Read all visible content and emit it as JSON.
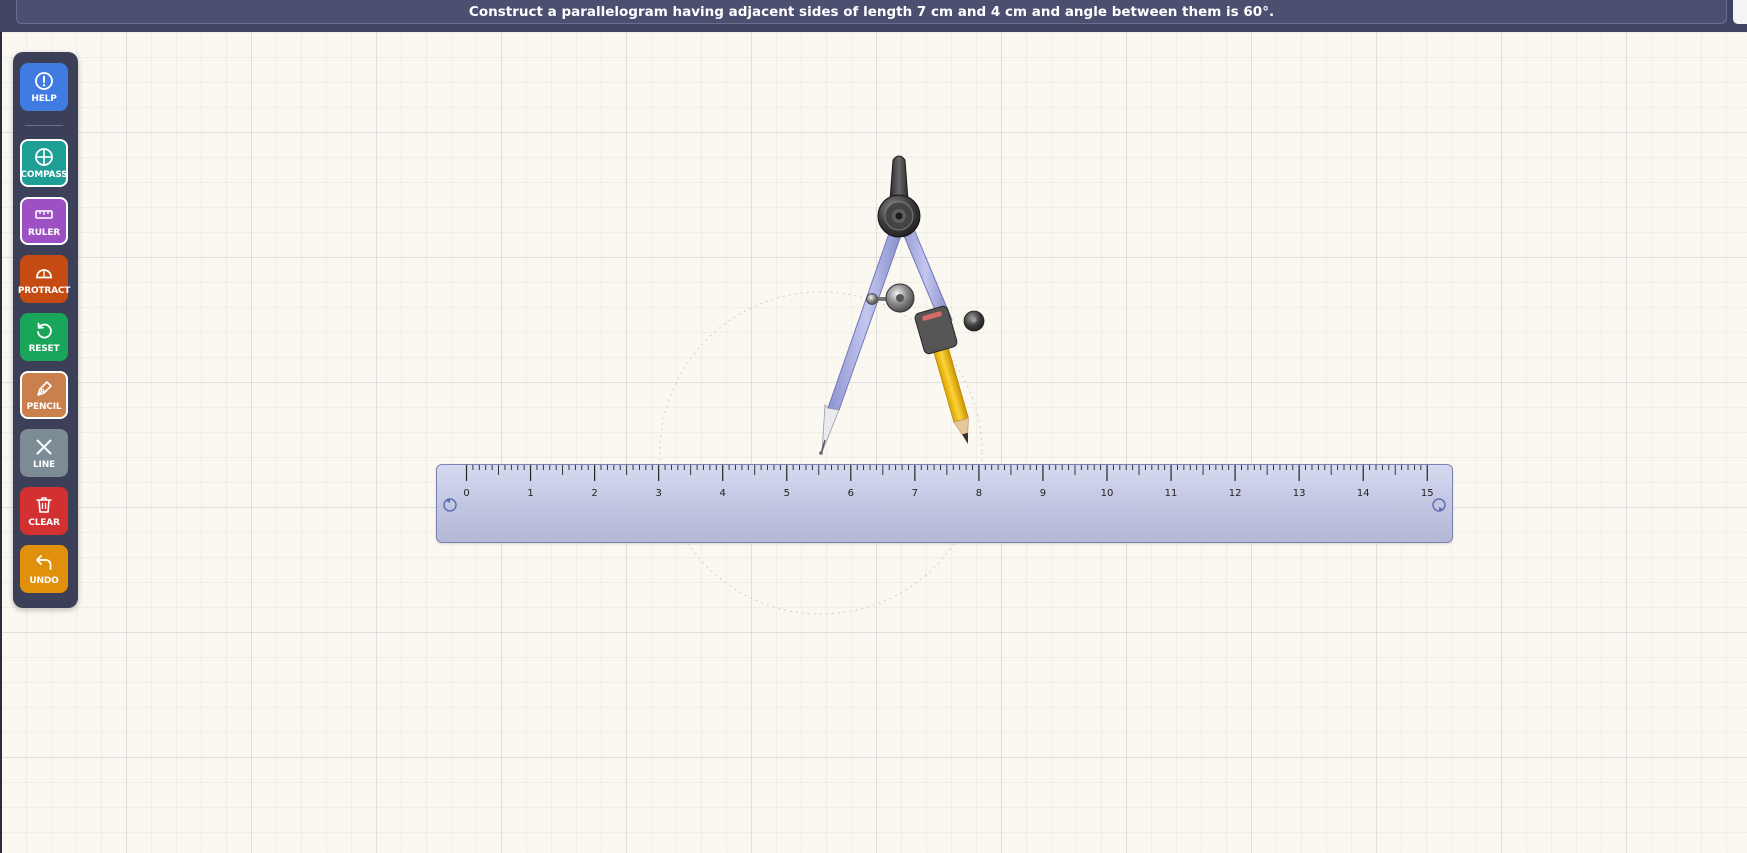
{
  "instruction": "Construct a parallelogram having adjacent sides of length 7 cm and 4 cm and angle between them is 60°.",
  "toolbar": {
    "help": {
      "label": "HELP",
      "color": "#3f7be0",
      "icon": "help-icon"
    },
    "compass": {
      "label": "COMPASS",
      "color": "#1f9e96",
      "icon": "compass-icon",
      "active": true
    },
    "ruler": {
      "label": "RULER",
      "color": "#9d4fc4",
      "icon": "ruler-icon",
      "active": true
    },
    "protract": {
      "label": "PROTRACT",
      "color": "#c64b12",
      "icon": "protractor-icon"
    },
    "reset": {
      "label": "RESET",
      "color": "#1aa65a",
      "icon": "reset-icon"
    },
    "pencil": {
      "label": "PENCIL",
      "color": "#c9804d",
      "icon": "pencil-icon",
      "active": true
    },
    "line": {
      "label": "LINE",
      "color": "#7c8b94",
      "icon": "line-icon"
    },
    "clear": {
      "label": "CLEAR",
      "color": "#d33131",
      "icon": "trash-icon"
    },
    "undo": {
      "label": "UNDO",
      "color": "#e0900b",
      "icon": "undo-icon"
    }
  },
  "ruler": {
    "labels": [
      "0",
      "1",
      "2",
      "3",
      "4",
      "5",
      "6",
      "7",
      "8",
      "9",
      "10",
      "11",
      "12",
      "13",
      "14",
      "15"
    ],
    "unit_cm": 15
  },
  "compass": {
    "needle_cm": 5.6,
    "pencil_cm": 8.0
  }
}
